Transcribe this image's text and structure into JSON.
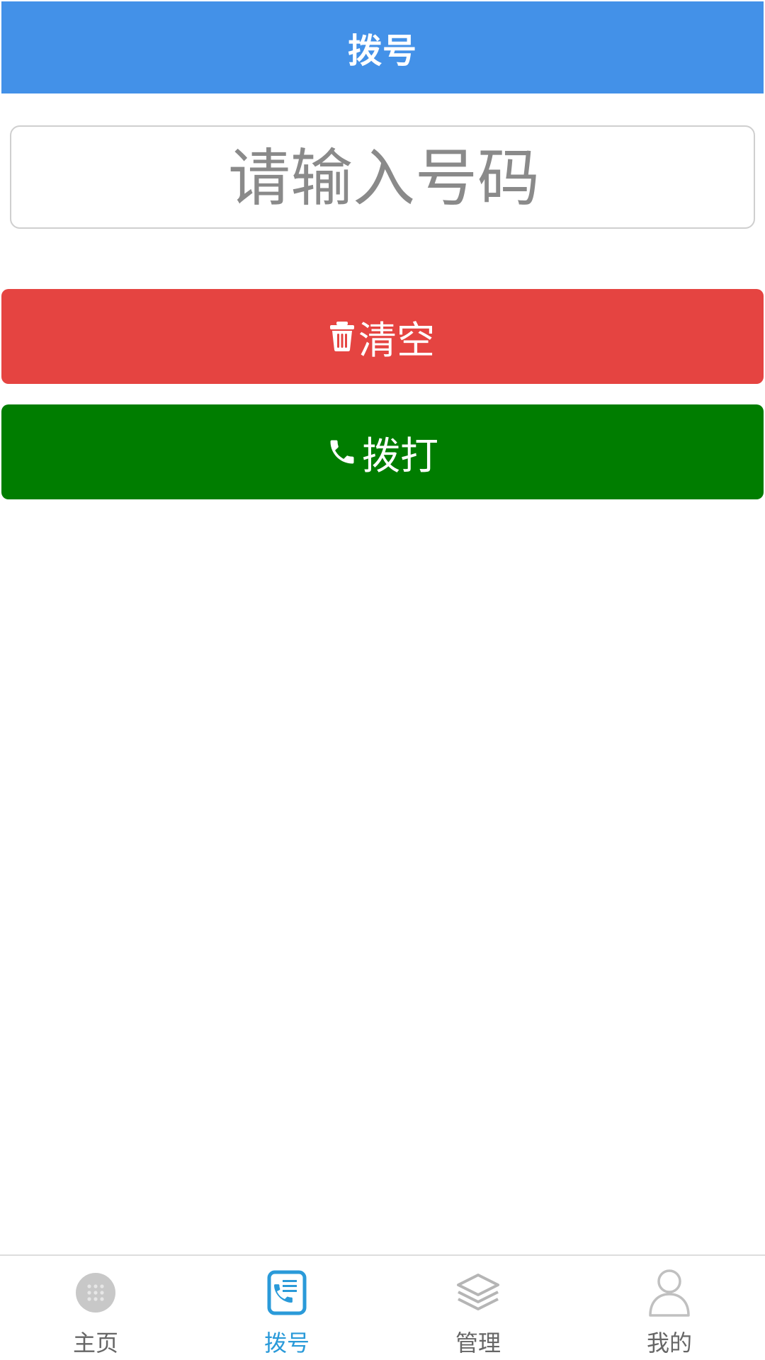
{
  "header": {
    "title": "拨号"
  },
  "phone_input": {
    "placeholder": "请输入号码",
    "value": ""
  },
  "buttons": {
    "clear_label": "清空",
    "clear_icon": "trash-icon",
    "clear_color": "#e54441",
    "call_label": "拨打",
    "call_icon": "phone-icon",
    "call_color": "#007d00"
  },
  "bottom_nav": {
    "items": [
      {
        "label": "主页",
        "icon": "grid-icon",
        "active": false
      },
      {
        "label": "拨号",
        "icon": "dialer-icon",
        "active": true
      },
      {
        "label": "管理",
        "icon": "layers-icon",
        "active": false
      },
      {
        "label": "我的",
        "icon": "user-icon",
        "active": false
      }
    ],
    "active_color": "#2a9ad9",
    "inactive_color": "#666666"
  },
  "colors": {
    "header_bg": "#4391e8"
  }
}
